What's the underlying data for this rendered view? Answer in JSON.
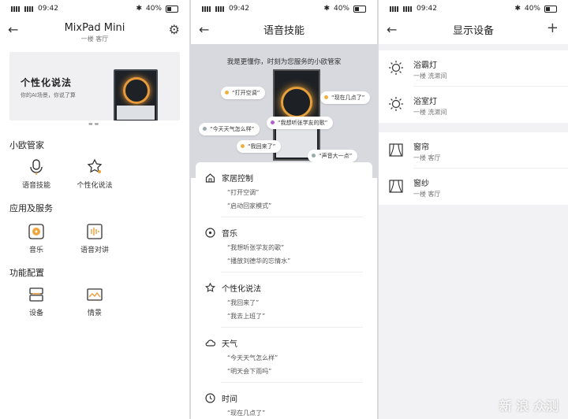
{
  "status": {
    "time": "09:42",
    "battery": "40%",
    "net": "4G"
  },
  "p1": {
    "title": "MixPad Mini",
    "subtitle": "一楼 客厅",
    "banner_title": "个性化说法",
    "banner_sub": "你的AI场景，你说了算",
    "sections": [
      {
        "title": "小欧管家",
        "items": [
          "语音技能",
          "个性化说法"
        ]
      },
      {
        "title": "应用及服务",
        "items": [
          "音乐",
          "语音对讲"
        ]
      },
      {
        "title": "功能配置",
        "items": [
          "设备",
          "情景"
        ]
      }
    ]
  },
  "p2": {
    "title": "语音技能",
    "tagline": "我是更懂你，时刻为您服务的小欧管家",
    "bubbles": [
      "“打开空调”",
      "“现在几点了”",
      "“今天天气怎么样”",
      "“我想听张学友的歌”",
      "“我回来了”",
      "“声音大一点”"
    ],
    "categories": [
      {
        "name": "家居控制",
        "q1": "“打开空调”",
        "q2": "“启动回家模式”"
      },
      {
        "name": "音乐",
        "q1": "“我想听张学友的歌”",
        "q2": "“播放刘德华的忘情水”"
      },
      {
        "name": "个性化说法",
        "q1": "“我回来了”",
        "q2": "“我去上班了”"
      },
      {
        "name": "天气",
        "q1": "“今天天气怎么样”",
        "q2": "“明天会下雨吗”"
      },
      {
        "name": "时间",
        "q1": "“现在几点了”",
        "q2": ""
      }
    ]
  },
  "p3": {
    "title": "显示设备",
    "devices": [
      {
        "name": "浴霸灯",
        "loc": "一楼 洗漱间"
      },
      {
        "name": "浴室灯",
        "loc": "一楼 洗漱间"
      },
      {
        "name": "窗帘",
        "loc": "一楼 客厅"
      },
      {
        "name": "窗纱",
        "loc": "一楼 客厅"
      }
    ]
  },
  "watermark": "新 浪 众测",
  "colors": {
    "accent": "#e8a03a",
    "hero_bg": "#d8d9df"
  }
}
